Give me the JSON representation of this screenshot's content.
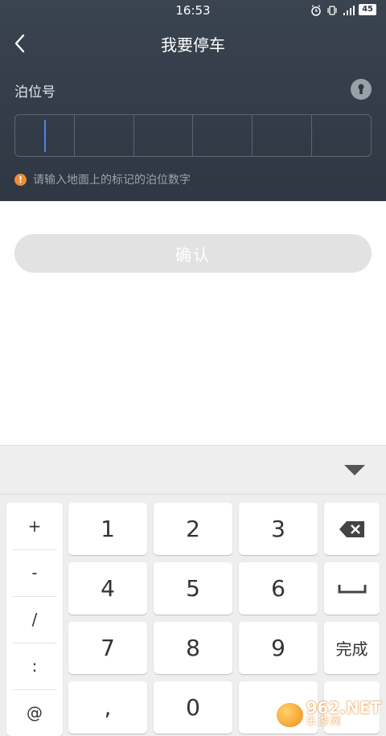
{
  "status_bar": {
    "time": "16:53",
    "battery": "45"
  },
  "header": {
    "title": "我要停车",
    "berth_label": "泊位号",
    "hint": "请输入地面上的标记的泊位数字",
    "code_cells": [
      "",
      "",
      "",
      "",
      "",
      ""
    ]
  },
  "confirm_button": {
    "label": "确认"
  },
  "keyboard": {
    "symbols": [
      "+",
      "-",
      "/",
      ":",
      "@"
    ],
    "keys": {
      "k1": "1",
      "k2": "2",
      "k3": "3",
      "k4": "4",
      "k5": "5",
      "k6": "6",
      "k7": "7",
      "k8": "8",
      "k9": "9",
      "comma": ",",
      "k0": "0",
      "done": "完成"
    }
  },
  "watermark": {
    "main": "962.NET",
    "sub": "乐游网"
  },
  "colors": {
    "header_bg": "#2f3743",
    "cursor": "#4a86e8",
    "hint_icon": "#f08c3a",
    "confirm_disabled": "#e2e2e2",
    "keyboard_bg": "#eeeeee"
  }
}
